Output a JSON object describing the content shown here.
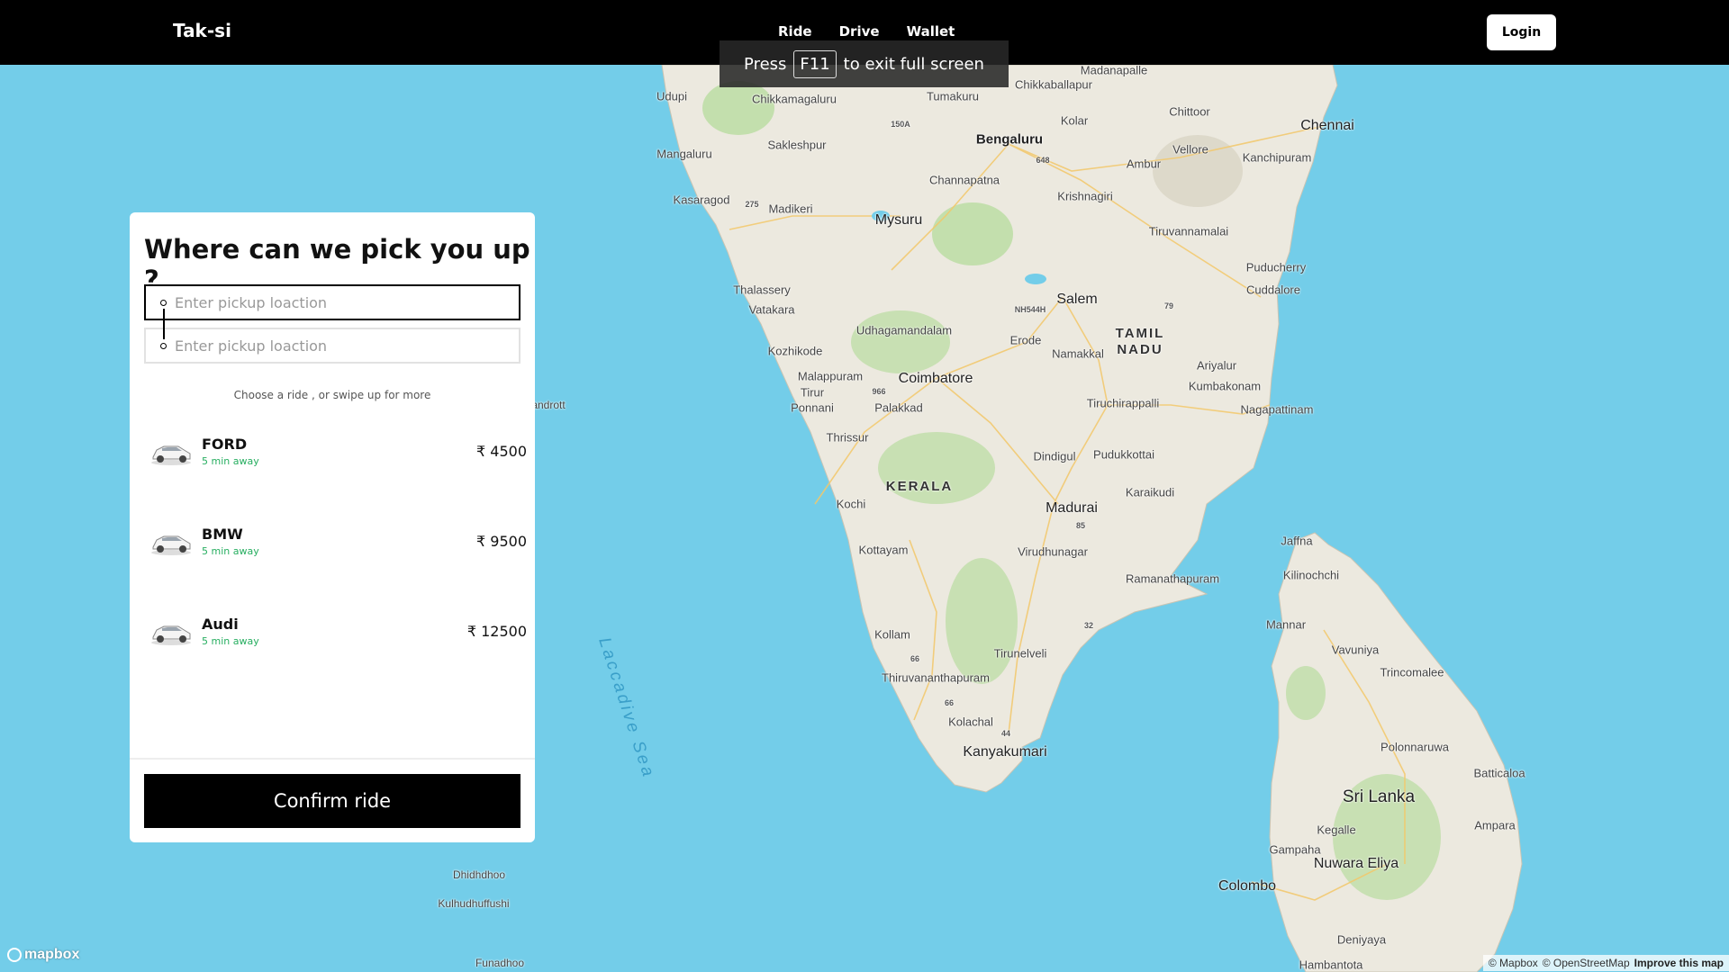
{
  "brand": "Tak-si",
  "nav": {
    "items": [
      "Ride",
      "Drive",
      "Wallet"
    ],
    "login": "Login"
  },
  "toast": {
    "press": "Press",
    "key": "F11",
    "rest": "to exit full screen"
  },
  "panel": {
    "title": "Where can we pick you up ?",
    "pickup_placeholder": "Enter pickup loaction",
    "dropoff_placeholder": "Enter pickup loaction",
    "hint": "Choose a ride , or swipe up for more",
    "rides": [
      {
        "name": "FORD",
        "eta": "5 min away",
        "price": "₹ 4500"
      },
      {
        "name": "BMW",
        "eta": "5 min away",
        "price": "₹ 9500"
      },
      {
        "name": "Audi",
        "eta": "5 min away",
        "price": "₹ 12500"
      }
    ],
    "confirm": "Confirm ride"
  },
  "map": {
    "land_color": "#ece9df",
    "water_color": "#73cde9",
    "green_color": "#b9dca0",
    "labels": [
      {
        "text": "Madanapalle"
      },
      {
        "text": "Udupi"
      },
      {
        "text": "Chikkaballapur"
      },
      {
        "text": "Chikkamagaluru"
      },
      {
        "text": "Tumakuru"
      },
      {
        "text": "Chittoor"
      },
      {
        "text": "Chennai"
      },
      {
        "text": "Kolar"
      },
      {
        "text": "Bengaluru"
      },
      {
        "text": "Sakleshpur"
      },
      {
        "text": "Mangaluru"
      },
      {
        "text": "Vellore"
      },
      {
        "text": "Kanchipuram"
      },
      {
        "text": "Ambur"
      },
      {
        "text": "Channapatna"
      },
      {
        "text": "Kasaragod"
      },
      {
        "text": "Krishnagiri"
      },
      {
        "text": "Madikeri"
      },
      {
        "text": "Mysuru"
      },
      {
        "text": "Tiruvannamalai"
      },
      {
        "text": "Puducherry"
      },
      {
        "text": "Cuddalore"
      },
      {
        "text": "Thalassery"
      },
      {
        "text": "Salem"
      },
      {
        "text": "Vatakara"
      },
      {
        "text": "Udhagamandalam"
      },
      {
        "text": "Erode"
      },
      {
        "text": "Namakkal"
      },
      {
        "text": "Kozhikode"
      },
      {
        "text": "Ariyalur"
      },
      {
        "text": "Kumbakonam"
      },
      {
        "text": "Malappuram"
      },
      {
        "text": "Coimbatore"
      },
      {
        "text": "Tirur"
      },
      {
        "text": "Tiruchirappalli"
      },
      {
        "text": "Palakkad"
      },
      {
        "text": "Ponnani"
      },
      {
        "text": "Nagapattinam"
      },
      {
        "text": "Thrissur"
      },
      {
        "text": "Dindigul"
      },
      {
        "text": "Pudukkottai"
      },
      {
        "text": "Karaikudi"
      },
      {
        "text": "Kochi"
      },
      {
        "text": "Madurai"
      },
      {
        "text": "Jaffna"
      },
      {
        "text": "Kilinochchi"
      },
      {
        "text": "Kottayam"
      },
      {
        "text": "Virudhunagar"
      },
      {
        "text": "Ramanathapuram"
      },
      {
        "text": "Mannar"
      },
      {
        "text": "Vavuniya"
      },
      {
        "text": "Kollam"
      },
      {
        "text": "Tirunelveli"
      },
      {
        "text": "Trincomalee"
      },
      {
        "text": "Thiruvananthapuram"
      },
      {
        "text": "Kolachal"
      },
      {
        "text": "Kanyakumari"
      },
      {
        "text": "Polonnaruwa"
      },
      {
        "text": "Batticaloa"
      },
      {
        "text": "Kegalle"
      },
      {
        "text": "Ampara"
      },
      {
        "text": "Gampaha"
      },
      {
        "text": "Nuwara Eliya"
      },
      {
        "text": "Colombo"
      },
      {
        "text": "Deniyaya"
      },
      {
        "text": "Hambantota"
      },
      {
        "text": "Dhidhdhoo"
      },
      {
        "text": "Kulhudhuffushi"
      },
      {
        "text": "Funadhoo"
      },
      {
        "text": "andrott"
      }
    ],
    "regions": [
      "TAMIL NADU",
      "KERALA"
    ],
    "country": "Sri Lanka",
    "sea": "Laccadive Sea",
    "shields": [
      "150A",
      "648",
      "275",
      "NH544H",
      "79",
      "966",
      "85",
      "32",
      "66",
      "66",
      "44"
    ]
  },
  "footer": {
    "logo": "mapbox",
    "attribution": [
      "© Mapbox",
      "© OpenStreetMap",
      "Improve this map"
    ]
  }
}
